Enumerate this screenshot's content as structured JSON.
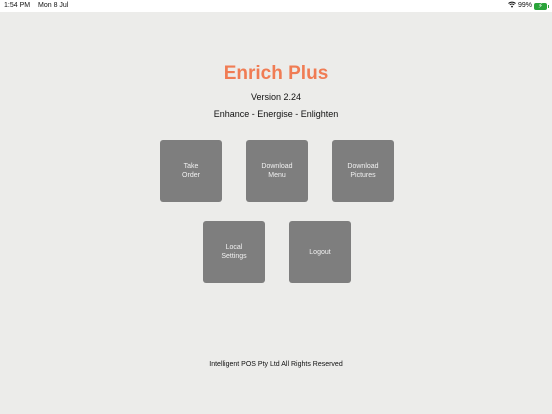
{
  "status_bar": {
    "time": "1:54 PM",
    "date": "Mon 8 Jul",
    "battery": "99%",
    "wifi_icon": "wifi-icon",
    "battery_icon": "battery-charging-icon"
  },
  "app": {
    "title": "Enrich Plus",
    "version": "Version 2.24",
    "tagline": "Enhance - Energise - Enlighten",
    "title_color": "#f07c54"
  },
  "menu": {
    "take_order": "Take\nOrder",
    "download_menu": "Download\nMenu",
    "download_pictures": "Download\nPictures",
    "local_settings": "Local\nSettings",
    "logout": "Logout",
    "tile_color": "#7e7e7e"
  },
  "footer": {
    "copyright": "Intelligent POS Pty Ltd All Rights Reserved"
  }
}
